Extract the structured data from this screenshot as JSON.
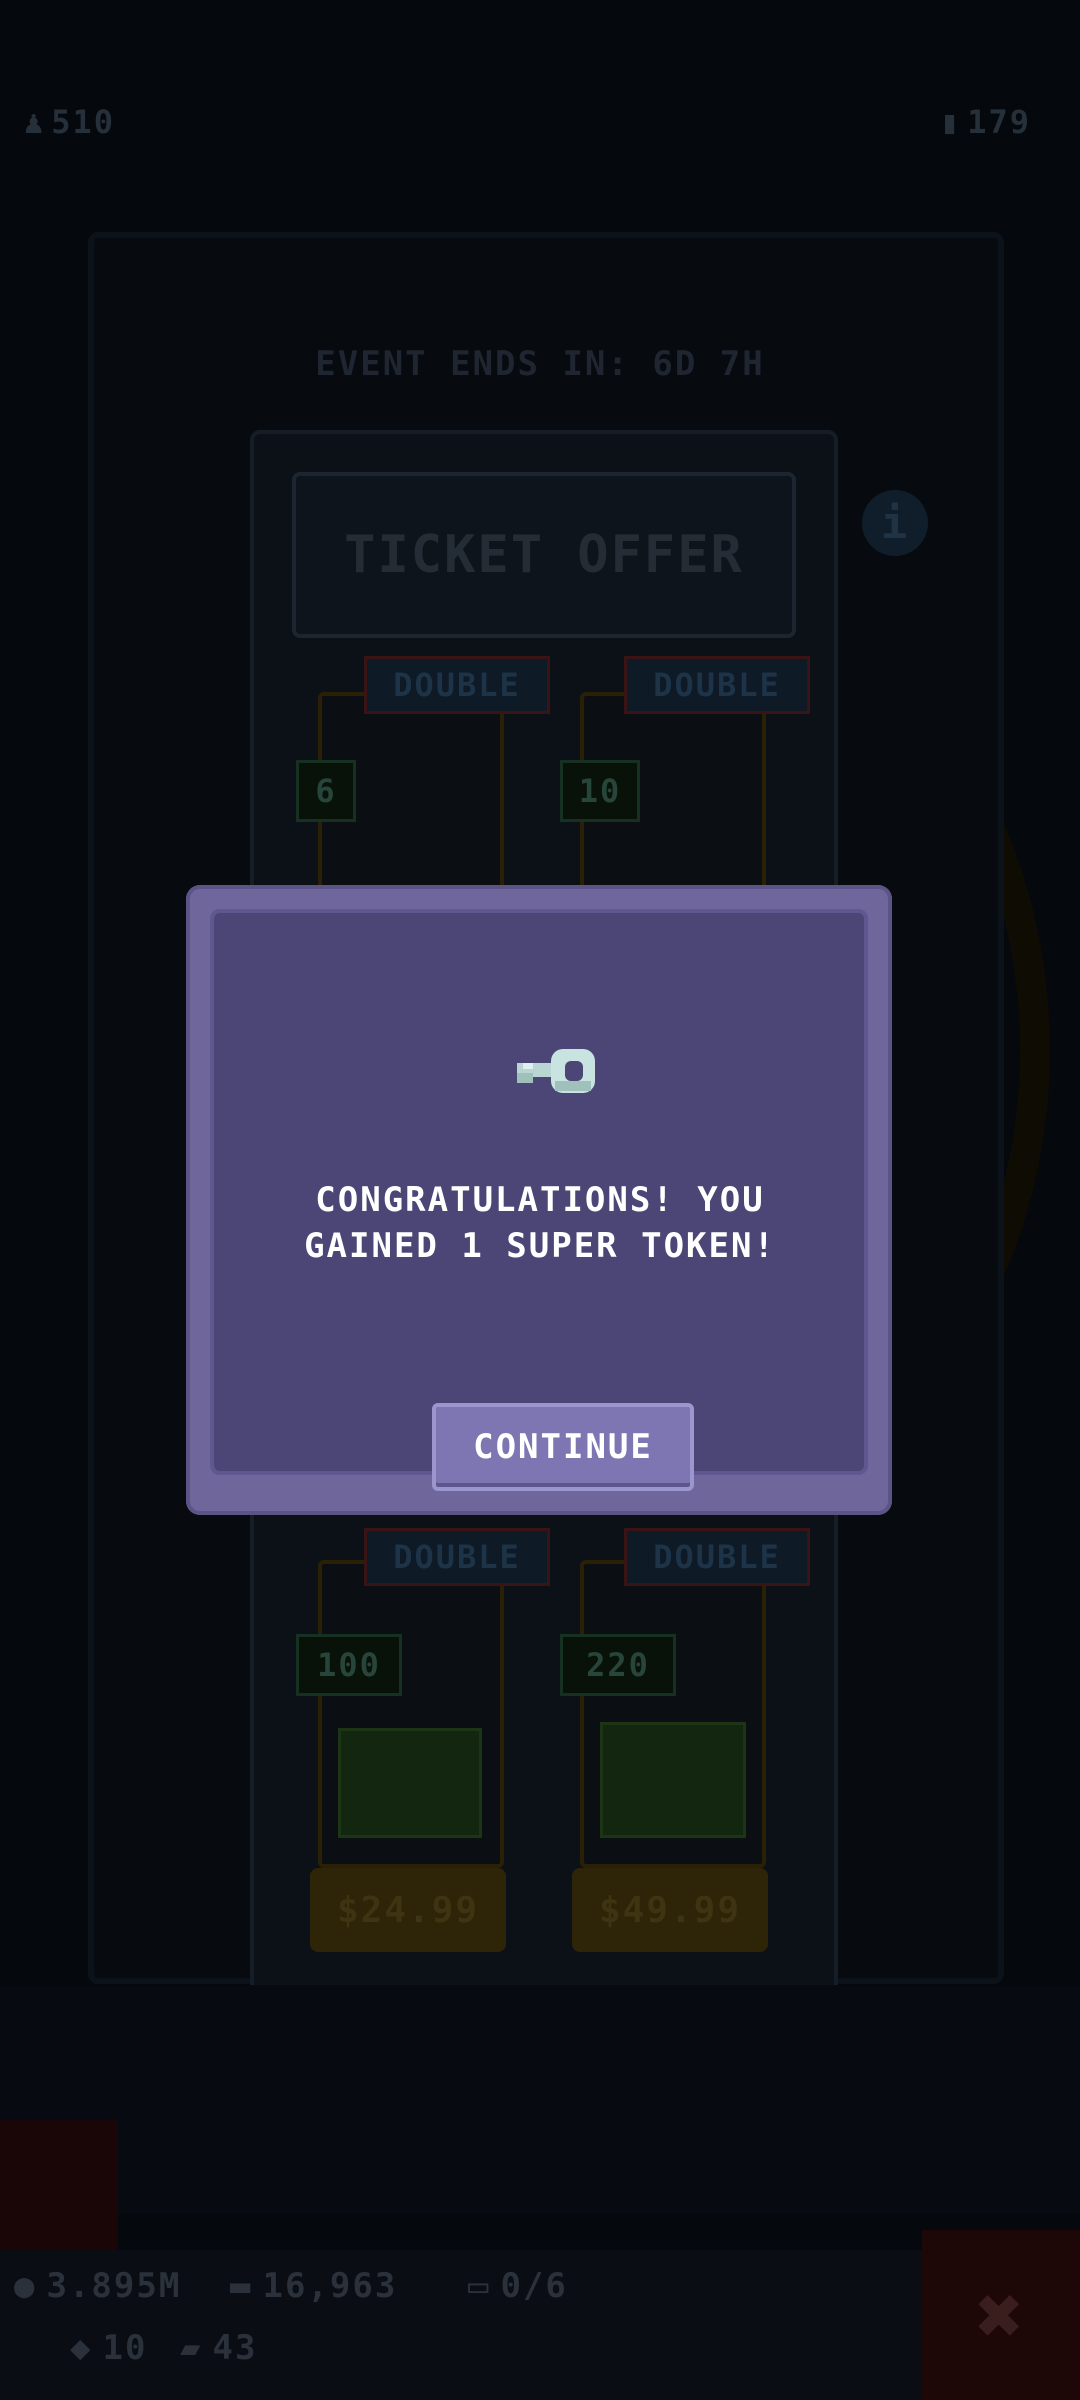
{
  "hud": {
    "top_left_value": "510",
    "top_right_value": "179"
  },
  "event": {
    "ends_text": "EVENT ENDS IN: 6D 7H"
  },
  "offer": {
    "title": "TICKET OFFER",
    "info_icon": "info-icon",
    "cards": [
      {
        "tag": "DOUBLE",
        "count": "6",
        "price": ""
      },
      {
        "tag": "DOUBLE",
        "count": "10",
        "price": ""
      },
      {
        "tag": "DOUBLE",
        "count": "100",
        "price": "$24.99"
      },
      {
        "tag": "DOUBLE",
        "count": "220",
        "price": "$49.99"
      }
    ]
  },
  "bottom_bar": {
    "coins": "3.895M",
    "cash": "16,963",
    "slots": "0/6",
    "gems": "10",
    "tickets": "43"
  },
  "modal": {
    "icon": "key-icon",
    "message_line1": "CONGRATULATIONS! YOU",
    "message_line2": "GAINED 1 SUPER TOKEN!",
    "continue_label": "CONTINUE"
  },
  "colors": {
    "modal_border": "#6f679c",
    "modal_fill": "#4c4676",
    "button": "#7d76b2",
    "text": "#ffffff"
  }
}
